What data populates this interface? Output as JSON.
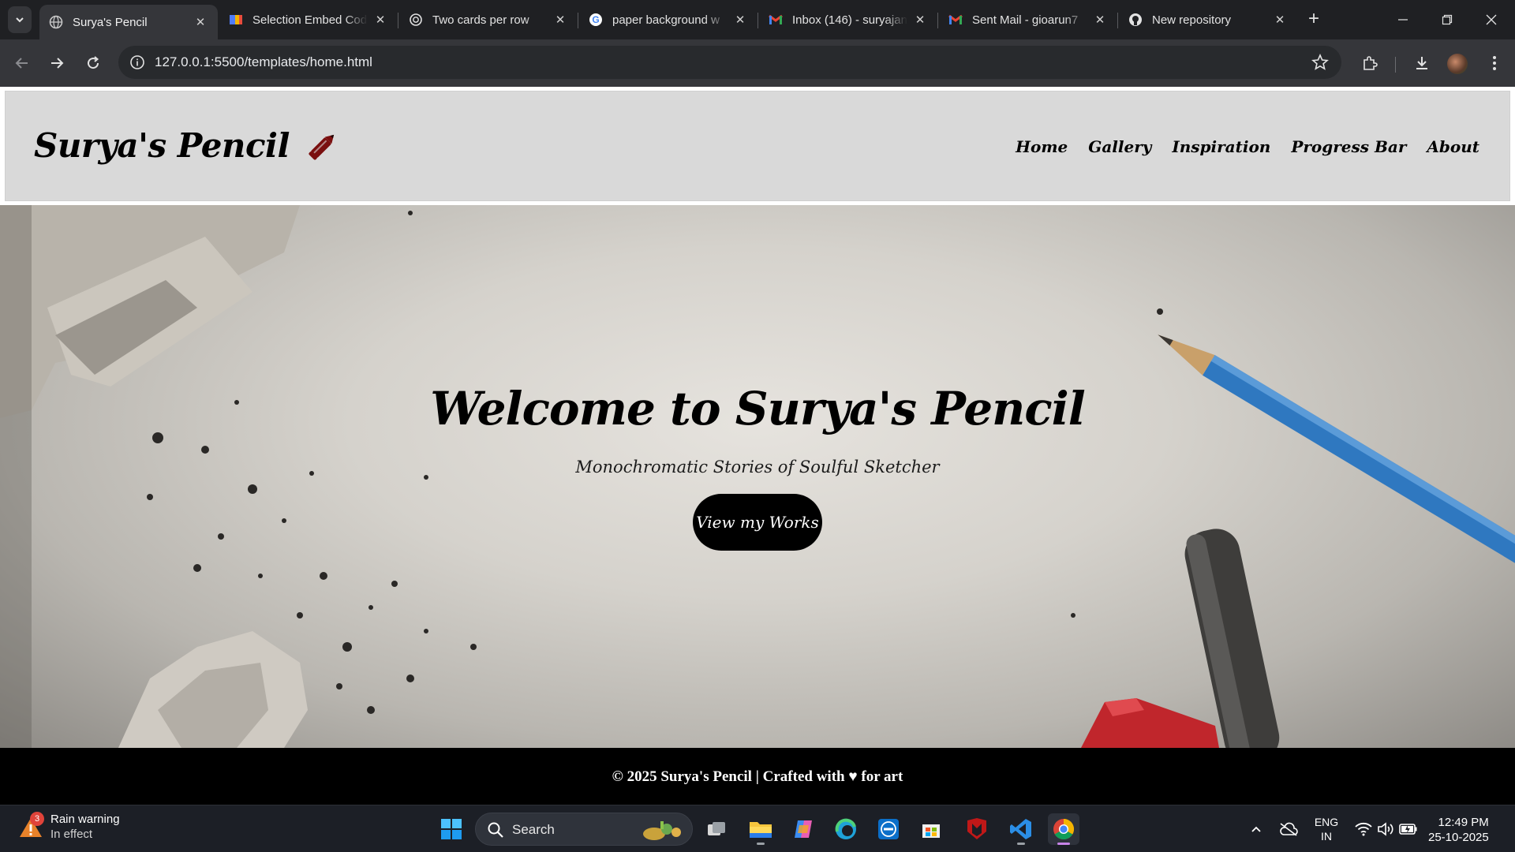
{
  "browser": {
    "tabs": [
      {
        "title": "Surya's Pencil",
        "favicon": "globe-icon",
        "active": true
      },
      {
        "title": "Selection Embed Code",
        "favicon": "app-icon",
        "active": false
      },
      {
        "title": "Two cards per row",
        "favicon": "chatgpt-icon",
        "active": false
      },
      {
        "title": "paper background w",
        "favicon": "google-icon",
        "active": false
      },
      {
        "title": "Inbox (146) - suryajan",
        "favicon": "gmail-icon",
        "active": false
      },
      {
        "title": "Sent Mail - gioarun7",
        "favicon": "gmail-icon",
        "active": false
      },
      {
        "title": "New repository",
        "favicon": "github-icon",
        "active": false
      }
    ],
    "url": "127.0.0.1:5500/templates/home.html"
  },
  "site": {
    "brand": "Surya's Pencil",
    "nav": [
      "Home",
      "Gallery",
      "Inspiration",
      "Progress Bar",
      "About"
    ],
    "hero": {
      "title": "Welcome to Surya's Pencil",
      "subtitle": "Monochromatic Stories of Soulful Sketcher",
      "cta": "View my Works"
    },
    "footer": "© 2025 Surya's Pencil | Crafted with ♥ for art"
  },
  "taskbar": {
    "weather": {
      "title": "Rain warning",
      "status": "In effect",
      "badge": "3"
    },
    "search_label": "Search",
    "language": {
      "code": "ENG",
      "region": "IN"
    },
    "time": "12:49 PM",
    "date": "25-10-2025"
  },
  "colors": {
    "header_bg": "#d9d9d9",
    "footer_bg": "#000000",
    "cta_bg": "#000000",
    "pencil_icon": "#7a0f0f",
    "chrome_bg": "#35363a"
  }
}
